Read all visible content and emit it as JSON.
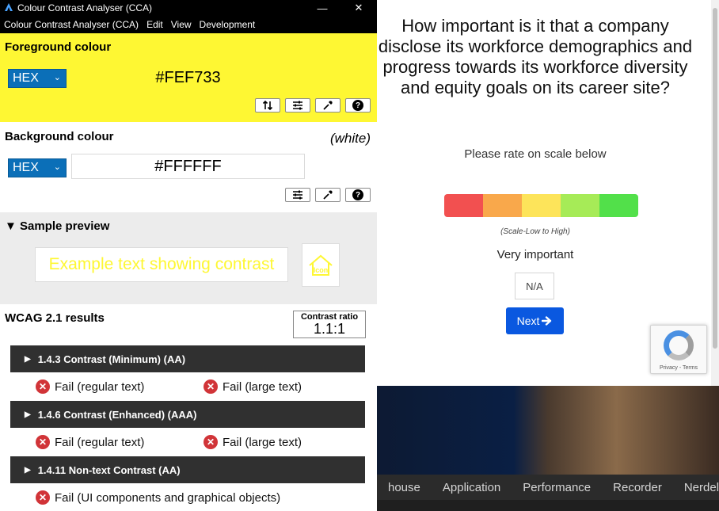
{
  "window": {
    "title": "Colour Contrast Analyser (CCA)",
    "minimize_glyph": "—",
    "close_glyph": "✕"
  },
  "menu": [
    "Colour Contrast Analyser (CCA)",
    "Edit",
    "View",
    "Development"
  ],
  "foreground": {
    "title": "Foreground colour",
    "format": "HEX",
    "value": "#FEF733",
    "color": "#fef733"
  },
  "background": {
    "title": "Background colour",
    "name": "(white)",
    "format": "HEX",
    "value": "#FFFFFF",
    "color": "#ffffff"
  },
  "sample": {
    "title": "Sample preview",
    "text": "Example text showing contrast",
    "icon_label": "Icon"
  },
  "results": {
    "title": "WCAG 2.1 results",
    "ratio_label": "Contrast ratio",
    "ratio_value": "1.1:1",
    "criteria": [
      {
        "label": "1.4.3 Contrast (Minimum) (AA)",
        "results": [
          "Fail (regular text)",
          "Fail (large text)"
        ]
      },
      {
        "label": "1.4.6 Contrast (Enhanced) (AAA)",
        "results": [
          "Fail (regular text)",
          "Fail (large text)"
        ]
      },
      {
        "label": "1.4.11 Non-text Contrast (AA)",
        "results": [
          "Fail (UI components and graphical objects)"
        ]
      }
    ]
  },
  "webpage": {
    "question": "How important is it that a company disclose its workforce demographics and progress towards its workforce diversity and equity goals on its career site?",
    "rate_prompt": "Please rate on scale below",
    "scale_colors": [
      "#f25050",
      "#f9a84b",
      "#fde45a",
      "#a6eb57",
      "#52e04a"
    ],
    "scale_caption": "(Scale-Low to High)",
    "selected": "Very important",
    "na_label": "N/A",
    "next_label": "Next",
    "recaptcha_text": "Privacy - Terms"
  },
  "devtools": {
    "tabs": [
      "house",
      "Application",
      "Performance",
      "Recorder",
      "Nerdel"
    ]
  }
}
